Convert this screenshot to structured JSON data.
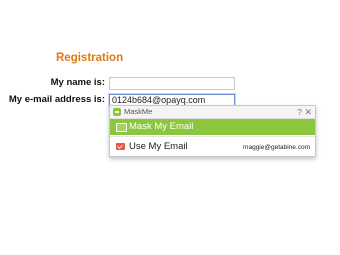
{
  "form": {
    "title": "Registration",
    "name_label": "My name is:",
    "name_value": "",
    "email_label": "My e-mail address is:",
    "email_value": "0124b684@opayq.com"
  },
  "popup": {
    "brand": "MaskMe",
    "help": "?",
    "close": "✕",
    "options": [
      {
        "label": "Mask My Email",
        "icon": "mask-icon",
        "selected": true
      },
      {
        "label": "Use My Email",
        "icon": "mail-icon",
        "email": "maggie@getabine.com"
      }
    ]
  },
  "colors": {
    "title": "#e07a10",
    "accent_green": "#8cc63f",
    "mail_red": "#e55b4a",
    "focus_border": "#6d8fd4"
  }
}
